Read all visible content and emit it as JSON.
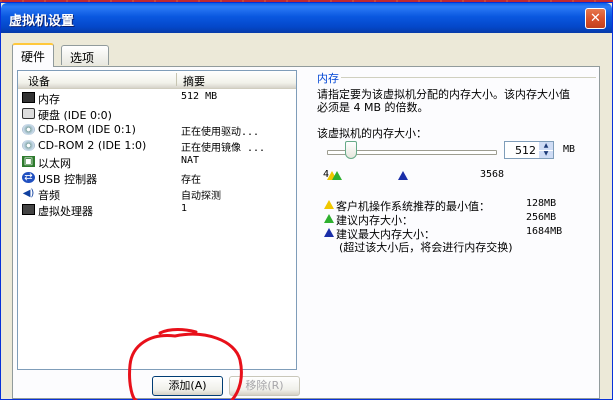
{
  "window": {
    "title": "虚拟机设置",
    "close_glyph": "✕"
  },
  "tabs": [
    {
      "label": "硬件",
      "active": true
    },
    {
      "label": "选项",
      "active": false
    }
  ],
  "device_table": {
    "columns": [
      "设备",
      "摘要"
    ],
    "rows": [
      {
        "icon": "memory-icon",
        "device": "内存",
        "summary": "512 MB",
        "selected": true
      },
      {
        "icon": "hard-disk-icon",
        "device": "硬盘 (IDE 0:0)",
        "summary": ""
      },
      {
        "icon": "cdrom-icon",
        "device": "CD-ROM (IDE 0:1)",
        "summary": "正在使用驱动..."
      },
      {
        "icon": "cdrom-icon",
        "device": "CD-ROM 2 (IDE 1:0)",
        "summary": "正在使用镜像 ..."
      },
      {
        "icon": "network-icon",
        "device": "以太网",
        "summary": "NAT"
      },
      {
        "icon": "usb-icon",
        "device": "USB 控制器",
        "summary": "存在"
      },
      {
        "icon": "sound-icon",
        "device": "音频",
        "summary": "自动探测"
      },
      {
        "icon": "processor-icon",
        "device": "虚拟处理器",
        "summary": "1"
      }
    ]
  },
  "buttons": {
    "add": "添加(A)",
    "remove": "移除(R)"
  },
  "memory_panel": {
    "group_title": "内存",
    "description": "请指定要为该虚拟机分配的内存大小。该内存大小值必须是 4 MB 的倍数。",
    "field_label": "该虚拟机的内存大小：",
    "value": "512",
    "unit": "MB",
    "slider_min": "4",
    "slider_max": "3568",
    "slider_fraction": 0.143,
    "legend": [
      {
        "marker": "yellow-triangle",
        "text": "客户机操作系统推荐的最小值：",
        "value": "128MB",
        "color": "#f0c800"
      },
      {
        "marker": "green-triangle",
        "text": "建议内存大小：",
        "value": "256MB",
        "color": "#2fb02f"
      },
      {
        "marker": "blue-triangle",
        "text": "建议最大内存大小：",
        "value": "1684MB",
        "color": "#1a2ea8"
      }
    ],
    "note": "(超过该大小后，将会进行内存交换)"
  }
}
